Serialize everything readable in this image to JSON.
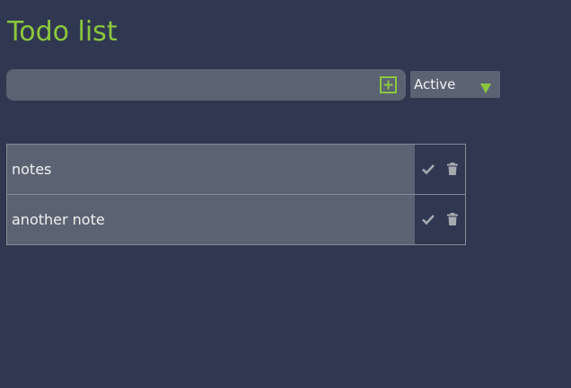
{
  "app": {
    "title": "Todo list"
  },
  "add_form": {
    "input_value": "",
    "add_icon": "plus-square-icon"
  },
  "filter": {
    "selected": "Active",
    "arrow_icon": "triangle-down-icon"
  },
  "todos": [
    {
      "text": "notes",
      "complete_icon": "check-icon",
      "delete_icon": "trash-icon"
    },
    {
      "text": "another note",
      "complete_icon": "check-icon",
      "delete_icon": "trash-icon"
    }
  ],
  "colors": {
    "background": "#2f3850",
    "accent": "#8dc63f",
    "panel": "#5b6373",
    "border": "#858b96",
    "icon": "#a6a9b0",
    "text": "#f0f0f0"
  }
}
